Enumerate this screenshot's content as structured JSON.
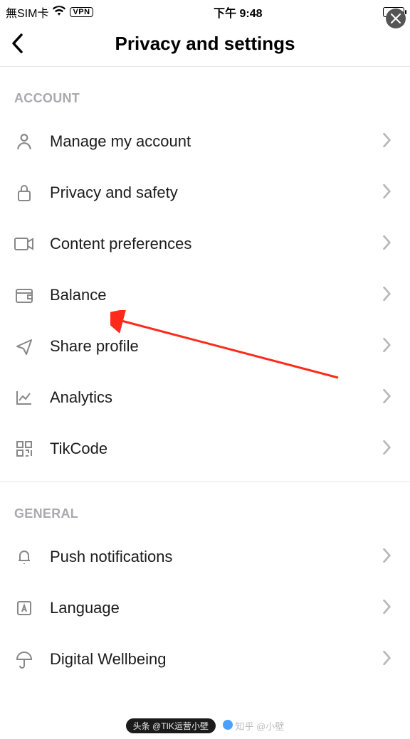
{
  "status": {
    "carrier": "無SIM卡",
    "vpn": "VPN",
    "time": "下午 9:48"
  },
  "header": {
    "title": "Privacy and settings"
  },
  "sections": [
    {
      "title": "ACCOUNT",
      "items": [
        {
          "label": "Manage my account"
        },
        {
          "label": "Privacy and safety"
        },
        {
          "label": "Content preferences"
        },
        {
          "label": "Balance"
        },
        {
          "label": "Share profile"
        },
        {
          "label": "Analytics"
        },
        {
          "label": "TikCode"
        }
      ]
    },
    {
      "title": "GENERAL",
      "items": [
        {
          "label": "Push notifications"
        },
        {
          "label": "Language"
        },
        {
          "label": "Digital Wellbeing"
        }
      ]
    }
  ],
  "watermark": {
    "left": "头条 @TIK运营小壁",
    "right": "知乎 @小壁"
  }
}
